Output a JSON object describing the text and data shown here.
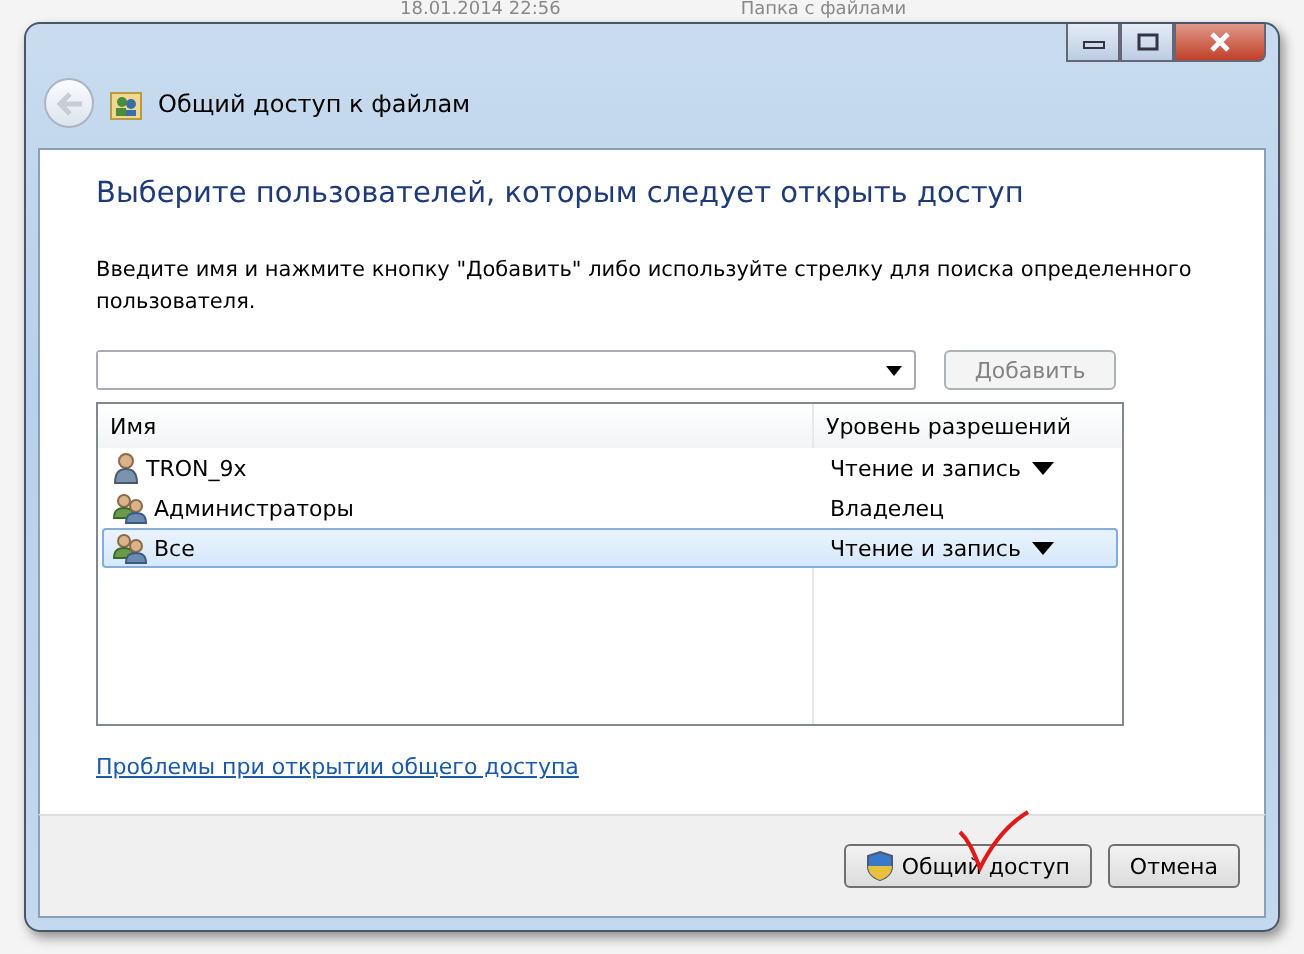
{
  "background": {
    "date": "18.01.2014 22:56",
    "type": "Папка с файлами"
  },
  "window": {
    "title": "Общий доступ к файлам"
  },
  "heading": "Выберите пользователей, которым следует открыть доступ",
  "instruction": "Введите имя и нажмите кнопку \"Добавить\" либо используйте стрелку для поиска определенного пользователя.",
  "name_field": {
    "add_button": "Добавить",
    "add_disabled": true
  },
  "table": {
    "columns": [
      "Имя",
      "Уровень разрешений"
    ],
    "rows": [
      {
        "kind": "user",
        "name": "TRON_9x",
        "permission": "Чтение и запись",
        "has_dropdown": true,
        "selected": false
      },
      {
        "kind": "group",
        "name": "Администраторы",
        "permission": "Владелец",
        "has_dropdown": false,
        "selected": false
      },
      {
        "kind": "group",
        "name": "Все",
        "permission": "Чтение и запись",
        "has_dropdown": true,
        "selected": true
      }
    ]
  },
  "help_link": "Проблемы при открытии общего доступа",
  "buttons": [
    {
      "kind": "shield",
      "label": "Общий доступ",
      "annotated": true
    },
    {
      "kind": "plain",
      "label": "Отмена",
      "annotated": false
    }
  ]
}
